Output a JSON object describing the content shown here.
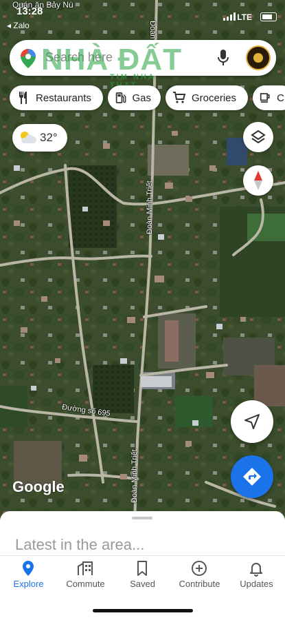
{
  "status_bar": {
    "time": "13:28",
    "back_app": "◂ Zalo",
    "network": "LTE"
  },
  "search": {
    "placeholder": "Search here",
    "watermark_text": "NHÀ ĐẤT",
    "watermark_sub": "TIM NHA THAT"
  },
  "map": {
    "top_place_label": "Quán ăn Bảy Nù",
    "road_labels": [
      "Đoàn Minh",
      "Đoàn Minh Triết",
      "Đường số 695",
      "Đoàn Minh Triết"
    ],
    "attribution": "Google"
  },
  "chips": [
    {
      "label": "Restaurants",
      "icon": "fork-knife-icon"
    },
    {
      "label": "Gas",
      "icon": "gas-pump-icon"
    },
    {
      "label": "Groceries",
      "icon": "cart-icon"
    },
    {
      "label": "C",
      "icon": "coffee-icon"
    }
  ],
  "weather": {
    "temp": "32°",
    "icon": "partly-cloudy-icon"
  },
  "sheet": {
    "title": "Latest in the area..."
  },
  "tabs": [
    {
      "label": "Explore",
      "icon": "pin-icon",
      "active": true
    },
    {
      "label": "Commute",
      "icon": "commute-icon",
      "active": false
    },
    {
      "label": "Saved",
      "icon": "bookmark-icon",
      "active": false
    },
    {
      "label": "Contribute",
      "icon": "plus-circle-icon",
      "active": false
    },
    {
      "label": "Updates",
      "icon": "bell-icon",
      "active": false
    }
  ],
  "colors": {
    "accent": "#1a73e8",
    "directions_fab": "#1a73e8",
    "compass_red": "#e53935"
  }
}
